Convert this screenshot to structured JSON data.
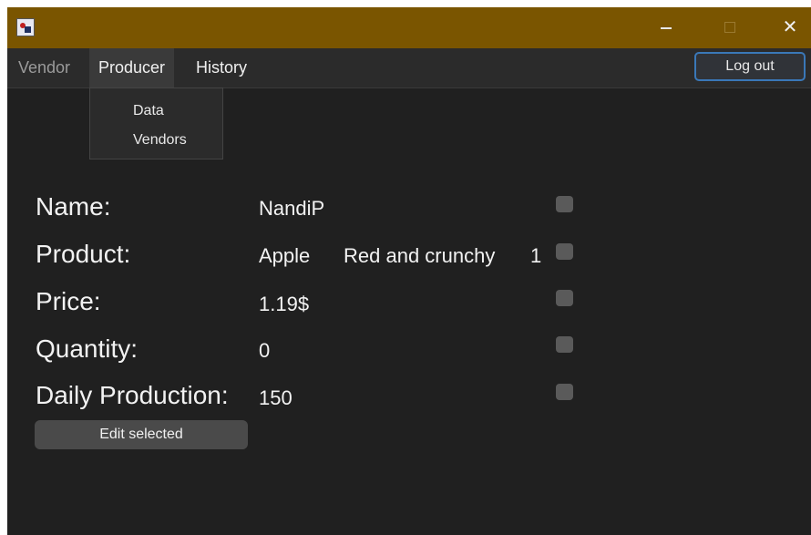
{
  "window": {
    "controls": {
      "minimize": "—",
      "maximize": "□",
      "close": "✕"
    }
  },
  "menubar": {
    "items": [
      {
        "label": "Vendor"
      },
      {
        "label": "Producer"
      },
      {
        "label": "History"
      }
    ],
    "logout_label": "Log out"
  },
  "producer_menu": {
    "items": [
      {
        "label": "Data"
      },
      {
        "label": "Vendors"
      }
    ]
  },
  "form": {
    "name": {
      "label": "Name:",
      "value": "NandiP"
    },
    "product": {
      "label": "Product:",
      "value": "Apple",
      "description": "Red and crunchy",
      "number": "1"
    },
    "price": {
      "label": "Price:",
      "value": "1.19$"
    },
    "quantity": {
      "label": "Quantity:",
      "value": "0"
    },
    "daily_production": {
      "label": "Daily Production:",
      "value": "150"
    },
    "edit_label": "Edit selected"
  },
  "colors": {
    "titlebar": "#7a5500",
    "background": "#202020",
    "menubar": "#2b2b2b",
    "accent_border": "#3a78b8"
  },
  "icons": {
    "app": "app-icon",
    "minimize": "minimize-icon",
    "maximize": "maximize-icon",
    "close": "close-icon"
  }
}
